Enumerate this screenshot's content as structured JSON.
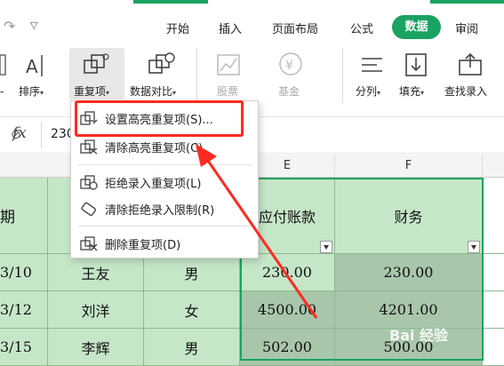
{
  "tabs": [
    {
      "label": "开始"
    },
    {
      "label": "插入"
    },
    {
      "label": "页面布局"
    },
    {
      "label": "公式"
    },
    {
      "label": "数据"
    },
    {
      "label": "审阅"
    }
  ],
  "ribbon": {
    "sort": "排序",
    "duplicates": "重复项",
    "compare": "数据对比",
    "stocks": "股票",
    "funds": "基金",
    "split": "分列",
    "fill": "填充",
    "lookup_entry": "查找录入"
  },
  "formula_bar": {
    "fx": "fx",
    "value": "230"
  },
  "menu": {
    "items": [
      {
        "label": "设置高亮重复项(S)..."
      },
      {
        "label": "清除高亮重复项(C)"
      },
      {
        "label": "拒绝录入重复项(L)"
      },
      {
        "label": "清除拒绝录入限制(R)"
      },
      {
        "label": "删除重复项(D)"
      }
    ]
  },
  "columns": [
    {
      "label": "E"
    },
    {
      "label": "F"
    }
  ],
  "table": {
    "headers": [
      "期",
      "应付账款",
      "财务"
    ],
    "rows": [
      [
        "3/10",
        "王友",
        "男",
        "230.00",
        "230.00"
      ],
      [
        "3/12",
        "刘洋",
        "女",
        "4500.00",
        "4201.00"
      ],
      [
        "3/15",
        "李辉",
        "男",
        "502.00",
        "500.00"
      ]
    ]
  },
  "watermark": "Bai 经验",
  "colors": {
    "accent": "#1aa260",
    "cell_green": "#c6e6c8",
    "cell_selected": "#a9c6ab",
    "highlight_red": "#ff2a1f"
  }
}
